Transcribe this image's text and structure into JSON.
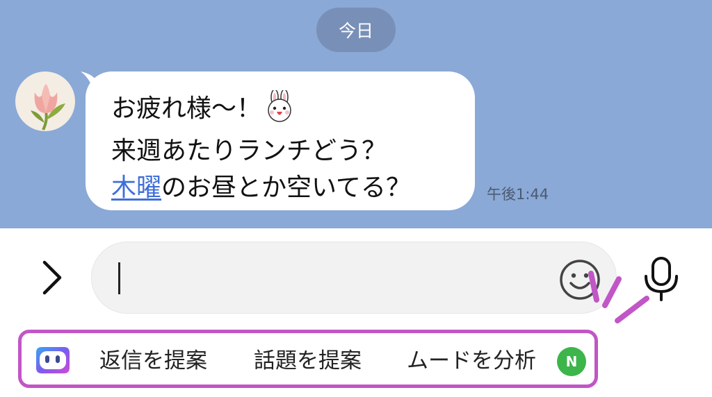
{
  "chat": {
    "date_label": "今日",
    "message": {
      "line1": "お疲れ様〜！",
      "line2": "来週あたりランチどう？",
      "line3_link": "木曜",
      "line3_rest": "のお昼とか空いてる？",
      "timestamp": "午後1:44",
      "sticker_icon": "bunny-emoji-icon"
    },
    "avatar_icon": "tulip-avatar-icon"
  },
  "composer": {
    "input_value": "",
    "icons": [
      "chevron-right-icon",
      "smiley-icon",
      "microphone-icon"
    ]
  },
  "ai_suggestions": {
    "bot_icon": "ai-bot-icon",
    "chips": [
      "返信を提案",
      "話題を提案",
      "ムードを分析"
    ],
    "new_badge": "N"
  },
  "colors": {
    "chat_background": "#8aa9d6",
    "highlight": "#c156c6",
    "link": "#3f6fd8",
    "badge": "#3cb54a"
  }
}
